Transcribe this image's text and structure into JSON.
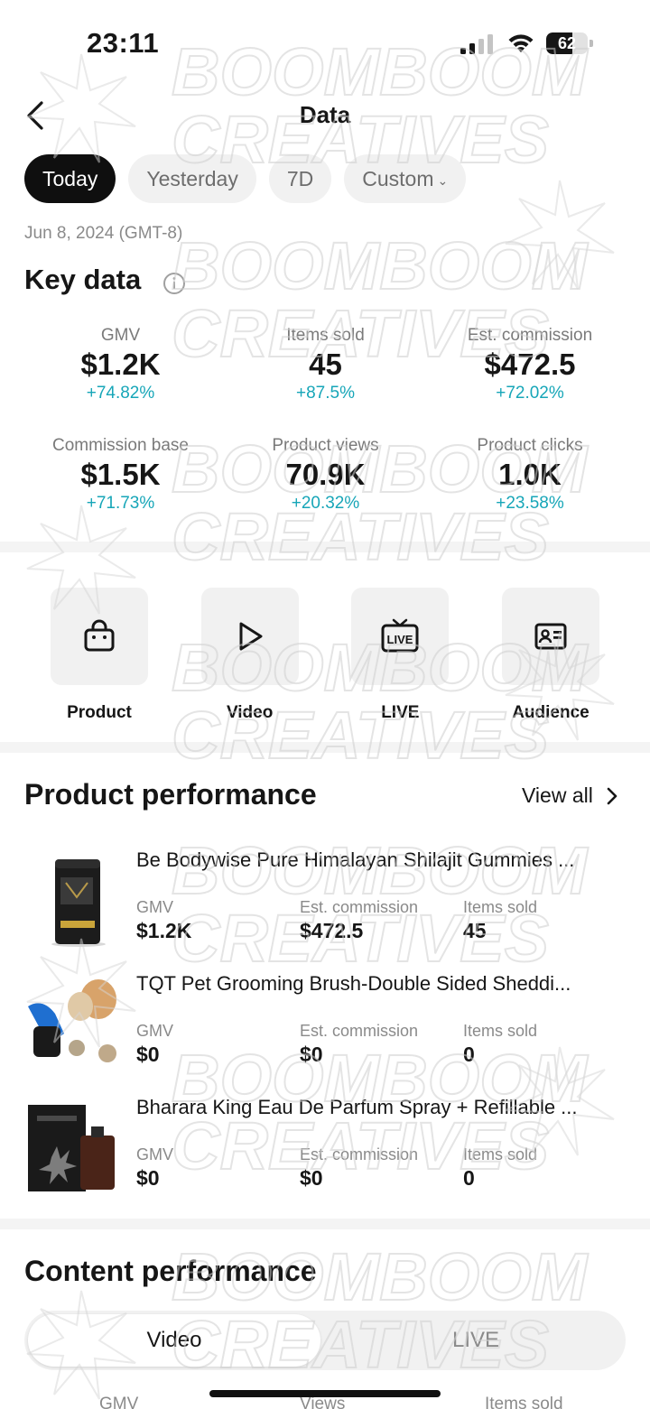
{
  "status": {
    "time": "23:11",
    "battery": "62"
  },
  "header": {
    "title": "Data"
  },
  "tabs": [
    {
      "label": "Today"
    },
    {
      "label": "Yesterday"
    },
    {
      "label": "7D"
    },
    {
      "label": "Custom",
      "icon": "chevron-down"
    }
  ],
  "date_line": "Jun 8, 2024 (GMT-8)",
  "key_data": {
    "title": "Key data",
    "metrics": [
      {
        "label": "GMV",
        "value": "$1.2K",
        "change": "+74.82%"
      },
      {
        "label": "Items sold",
        "value": "45",
        "change": "+87.5%"
      },
      {
        "label": "Est. commission",
        "value": "$472.5",
        "change": "+72.02%"
      },
      {
        "label": "Commission base",
        "value": "$1.5K",
        "change": "+71.73%"
      },
      {
        "label": "Product views",
        "value": "70.9K",
        "change": "+20.32%"
      },
      {
        "label": "Product clicks",
        "value": "1.0K",
        "change": "+23.58%"
      }
    ]
  },
  "quick_nav": [
    {
      "label": "Product",
      "icon": "shopping-bag-icon"
    },
    {
      "label": "Video",
      "icon": "play-icon"
    },
    {
      "label": "LIVE",
      "icon": "live-tv-icon"
    },
    {
      "label": "Audience",
      "icon": "id-card-icon"
    }
  ],
  "product_performance": {
    "title": "Product performance",
    "view_all": "View all",
    "stat_labels": {
      "gmv": "GMV",
      "commission": "Est. commission",
      "items": "Items sold"
    },
    "products": [
      {
        "name": "Be Bodywise Pure Himalayan Shilajit Gummies ...",
        "gmv": "$1.2K",
        "commission": "$472.5",
        "items": "45"
      },
      {
        "name": "TQT Pet Grooming Brush-Double Sided Sheddi...",
        "gmv": "$0",
        "commission": "$0",
        "items": "0"
      },
      {
        "name": "Bharara King Eau De Parfum Spray + Refillable ...",
        "gmv": "$0",
        "commission": "$0",
        "items": "0"
      }
    ]
  },
  "content_performance": {
    "title": "Content performance",
    "tabs": [
      "Video",
      "LIVE"
    ],
    "columns": [
      "GMV",
      "Views",
      "Items sold"
    ]
  },
  "watermark": {
    "line1": "BOOMBOOM",
    "line2": "CREATIVES"
  },
  "colors": {
    "accent_change": "#17a6b8",
    "active_tab": "#0f0f0f"
  }
}
